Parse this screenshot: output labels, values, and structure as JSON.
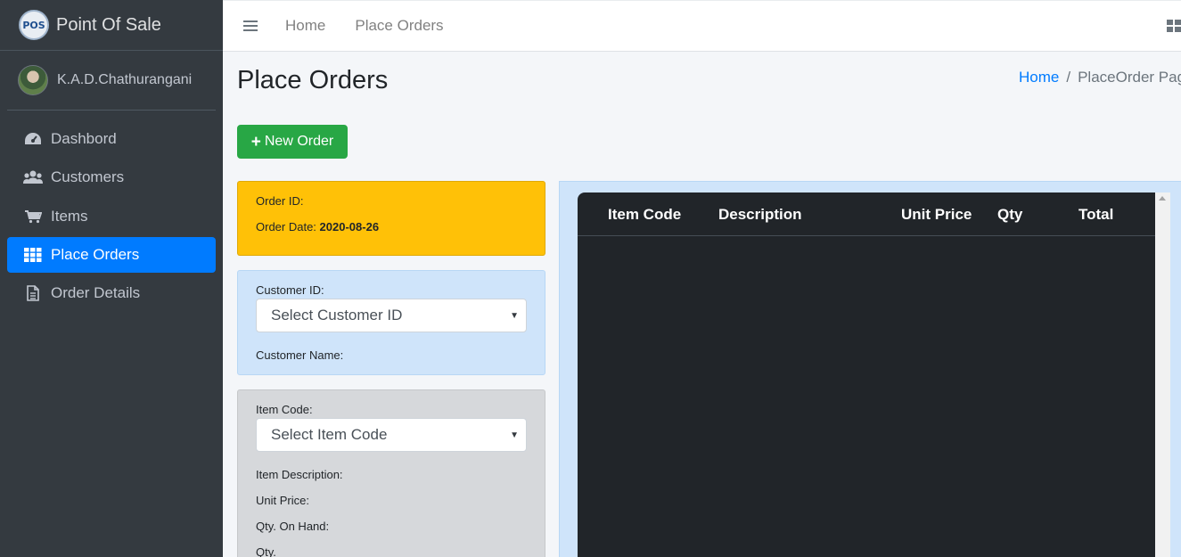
{
  "brand": {
    "logo_text": "POS",
    "title": "Point Of Sale"
  },
  "user": {
    "name": "K.A.D.Chathurangani"
  },
  "sidebar": {
    "items": [
      {
        "label": "Dashbord",
        "icon": "tachometer-icon",
        "active": false
      },
      {
        "label": "Customers",
        "icon": "users-icon",
        "active": false
      },
      {
        "label": "Items",
        "icon": "cart-icon",
        "active": false
      },
      {
        "label": "Place Orders",
        "icon": "grid-icon",
        "active": true
      },
      {
        "label": "Order Details",
        "icon": "document-icon",
        "active": false
      }
    ]
  },
  "topbar": {
    "links": [
      "Home",
      "Place Orders"
    ]
  },
  "page": {
    "title": "Place Orders",
    "breadcrumb": {
      "home": "Home",
      "separator": "/",
      "current": "PlaceOrder Page"
    }
  },
  "actions": {
    "new_order": "New Order"
  },
  "order": {
    "id_label": "Order ID:",
    "date_label": "Order Date:",
    "date_value": "2020-08-26"
  },
  "customer": {
    "id_label": "Customer ID:",
    "select_value": "Select Customer ID",
    "name_label": "Customer Name:"
  },
  "item": {
    "code_label": "Item Code:",
    "select_value": "Select Item Code",
    "description_label": "Item Description:",
    "unit_price_label": "Unit Price:",
    "qty_on_hand_label": "Qty. On Hand:",
    "qty_label": "Qty."
  },
  "table": {
    "columns": [
      "Item Code",
      "Description",
      "Unit Price",
      "Qty",
      "Total"
    ]
  },
  "colors": {
    "sidebar": "#343a40",
    "active": "#007bff",
    "success": "#28a745",
    "warning": "#ffc107",
    "info_light": "#cfe4fa",
    "dark_table": "#212529"
  }
}
